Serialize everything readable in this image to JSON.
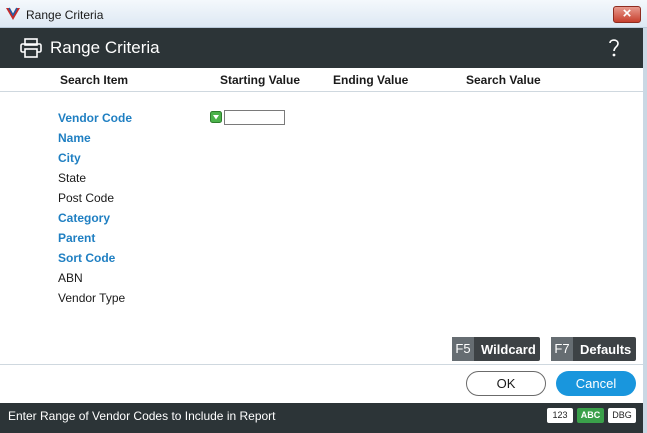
{
  "window": {
    "title": "Range Criteria"
  },
  "header": {
    "title": "Range Criteria"
  },
  "columns": {
    "search_item": "Search Item",
    "starting_value": "Starting Value",
    "ending_value": "Ending Value",
    "search_value": "Search Value"
  },
  "items": [
    {
      "label": "Vendor Code",
      "emphasis": true
    },
    {
      "label": "Name",
      "emphasis": true
    },
    {
      "label": "City",
      "emphasis": true
    },
    {
      "label": "State",
      "emphasis": false
    },
    {
      "label": "Post Code",
      "emphasis": false
    },
    {
      "label": "Category",
      "emphasis": true
    },
    {
      "label": "Parent",
      "emphasis": true
    },
    {
      "label": "Sort Code",
      "emphasis": true
    },
    {
      "label": "ABN",
      "emphasis": false
    },
    {
      "label": "Vendor Type",
      "emphasis": false
    }
  ],
  "starting_value_input": {
    "value": ""
  },
  "function_keys": {
    "wildcard": {
      "key": "F5",
      "label": "Wildcard"
    },
    "defaults": {
      "key": "F7",
      "label": "Defaults"
    }
  },
  "buttons": {
    "ok": "OK",
    "cancel": "Cancel"
  },
  "status": {
    "text": "Enter Range of Vendor Codes to Include in Report",
    "badges": {
      "num": "123",
      "abc": "ABC",
      "dbg": "DBG"
    }
  },
  "colors": {
    "accent": "#1996dd",
    "label_blue": "#1f7fc2",
    "header_bg": "#2c3437",
    "active_badge": "#3aa04a"
  }
}
